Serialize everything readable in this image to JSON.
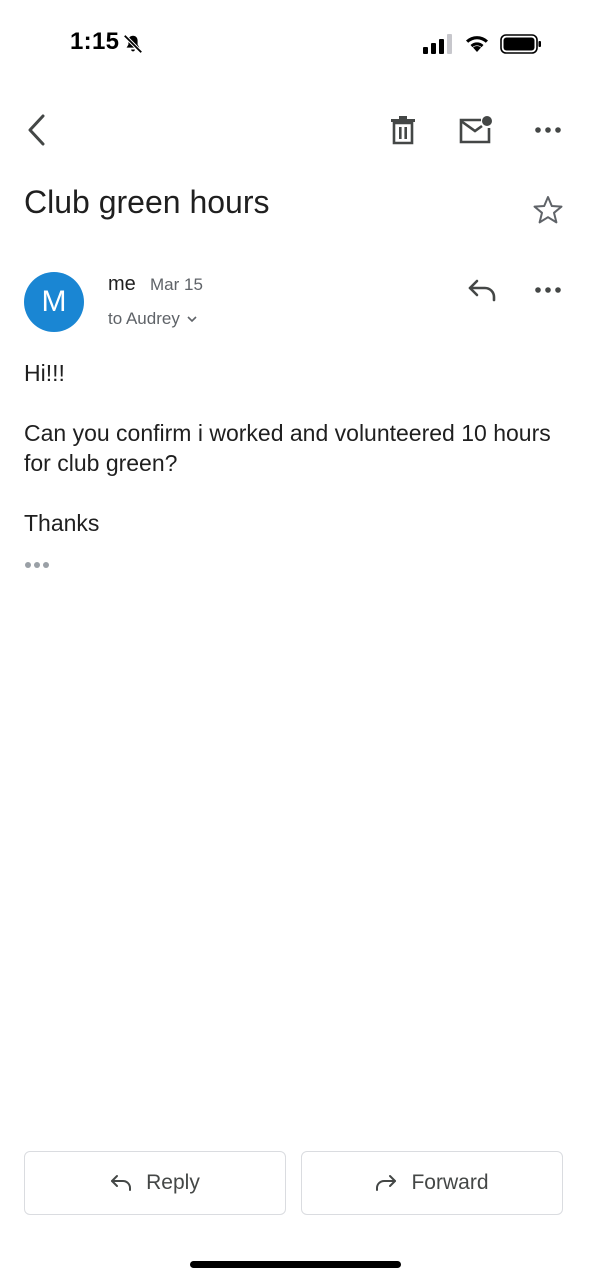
{
  "status_bar": {
    "time": "1:15"
  },
  "email": {
    "subject": "Club green hours",
    "sender_name": "me",
    "sender_initial": "M",
    "date": "Mar 15",
    "to_line": "to Audrey",
    "body": [
      "Hi!!!",
      "Can you confirm i worked and volunteered 10 hours for club green?",
      "Thanks"
    ]
  },
  "actions": {
    "reply_label": "Reply",
    "forward_label": "Forward"
  },
  "colors": {
    "avatar": "#1a86d3",
    "icon": "#5f6368",
    "border": "#dadce0"
  },
  "icons": [
    "back-arrow-icon",
    "trash-icon",
    "mark-unread-icon",
    "more-icon",
    "star-icon",
    "reply-icon",
    "forward-icon",
    "bell-slash-icon",
    "signal-icon",
    "wifi-icon",
    "battery-icon"
  ]
}
